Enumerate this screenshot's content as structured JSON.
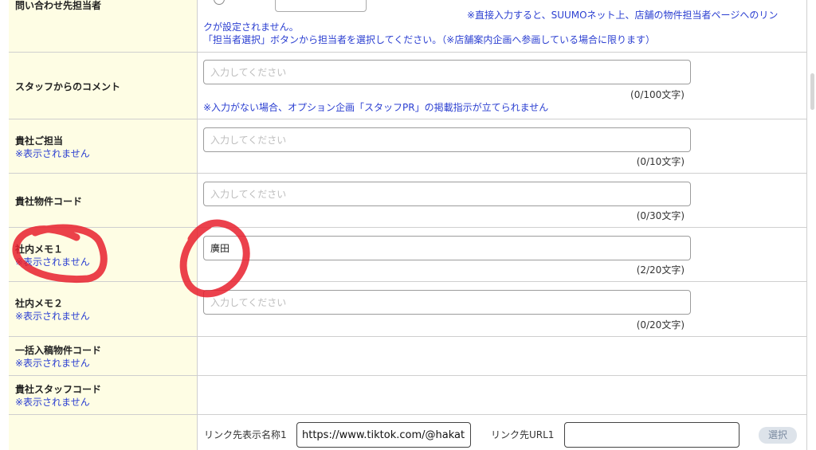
{
  "rows": {
    "contact_person": {
      "label": "問い合わせ先担当者",
      "note_line1": "※直接入力すると、SUUMOネット上、店舗の物件担当者ページへのリン",
      "note_line2": "クが設定されません。",
      "note_line3": "「担当者選択」ボタンから担当者を選択してください。（※店舗案内企画へ参画している場合に限ります）"
    },
    "staff_comment": {
      "label": "スタッフからのコメント",
      "placeholder": "入力してください",
      "value": "",
      "counter": "(0/100文字)",
      "note": "※入力がない場合、オプション企画「スタッフPR」の掲載指示が立てられません"
    },
    "company_person": {
      "label": "貴社ご担当",
      "sub": "※表示されません",
      "placeholder": "入力してください",
      "value": "",
      "counter": "(0/10文字)"
    },
    "property_code": {
      "label": "貴社物件コード",
      "placeholder": "入力してください",
      "value": "",
      "counter": "(0/30文字)"
    },
    "memo1": {
      "label": "社内メモ１",
      "sub": "※表示されません",
      "placeholder": "入力してください",
      "value": "廣田",
      "counter": "(2/20文字)"
    },
    "memo2": {
      "label": "社内メモ２",
      "sub": "※表示されません",
      "placeholder": "入力してください",
      "value": "",
      "counter": "(0/20文字)"
    },
    "bulk_code": {
      "label": "一括入稿物件コード",
      "sub": "※表示されません"
    },
    "staff_code": {
      "label": "貴社スタッフコード",
      "sub": "※表示されません"
    },
    "link": {
      "name_label": "リンク先表示名称1",
      "name_value": "https://www.tiktok.com/@hakatat",
      "url_label": "リンク先URL1",
      "url_value": "",
      "select_label": "選択"
    }
  },
  "colors": {
    "label_bg": "#fefde4",
    "note_blue": "#2b3fd1",
    "annotation_red": "#e8202e"
  }
}
